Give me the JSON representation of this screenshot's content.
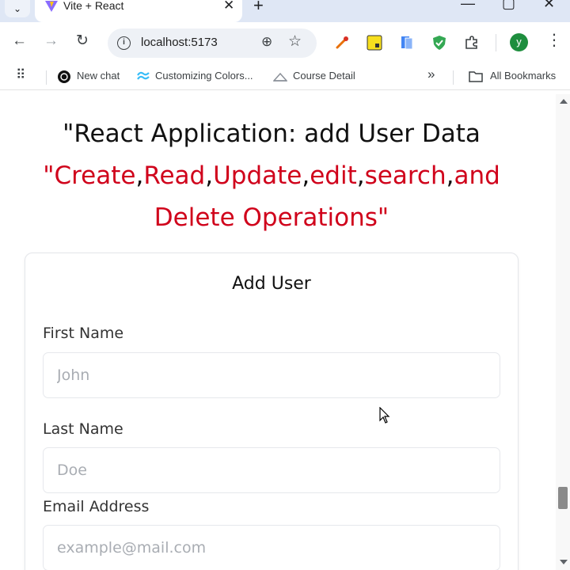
{
  "browser": {
    "tab": {
      "title": "Vite + React",
      "close_glyph": "✕"
    },
    "tab_list_glyph": "⌄",
    "new_tab_glyph": "+",
    "window_controls": {
      "minimize": "—",
      "maximize": "▢",
      "close": "✕"
    },
    "nav": {
      "back": "←",
      "forward": "→",
      "reload": "↻"
    },
    "address_bar": {
      "url": "localhost:5173",
      "info": "i",
      "zoom": "⊕",
      "star": "☆"
    },
    "profile_initial": "y",
    "menu": "⋮",
    "bookmarks": {
      "apps_glyph": "⠿",
      "items": [
        {
          "label": "New chat"
        },
        {
          "label": "Customizing Colors..."
        },
        {
          "label": "Course Detail"
        }
      ],
      "overflow": "»",
      "all_bookmarks": "All Bookmarks"
    }
  },
  "page": {
    "heading_line1": "\"React Application: add User Data",
    "heading_words": {
      "quote_open": "\"",
      "create": "Create",
      "read": "Read",
      "update": "Update",
      "edit": "edit",
      "search": "search",
      "and": "and",
      "delete_ops": "Delete Operations\"",
      "comma": ","
    },
    "form": {
      "title": "Add User",
      "first_name": {
        "label": "First Name",
        "placeholder": "John",
        "value": ""
      },
      "last_name": {
        "label": "Last Name",
        "placeholder": "Doe",
        "value": ""
      },
      "email": {
        "label": "Email Address",
        "placeholder": "example@mail.com",
        "value": ""
      }
    }
  },
  "colors": {
    "accent_red": "#d0021b",
    "tabstrip": "#dfe7f5",
    "omnibox": "#eef1f6",
    "profile": "#1e8e3e"
  }
}
